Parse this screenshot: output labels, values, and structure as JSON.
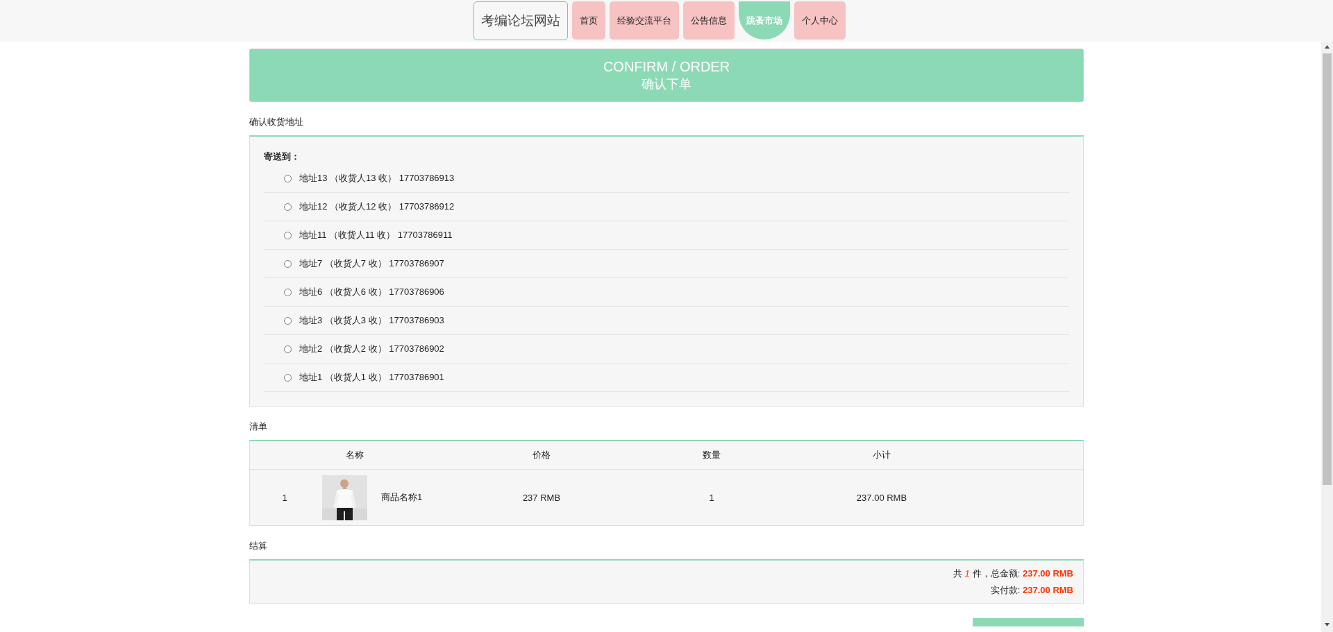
{
  "nav": {
    "brand": "考编论坛网站",
    "items": [
      {
        "label": "首页",
        "selected": false
      },
      {
        "label": "经验交流平台",
        "selected": false
      },
      {
        "label": "公告信息",
        "selected": false
      },
      {
        "label": "跳蚤市场",
        "selected": true
      },
      {
        "label": "个人中心",
        "selected": false
      }
    ]
  },
  "header": {
    "title": "CONFIRM / ORDER",
    "subtitle": "确认下单"
  },
  "address_section": {
    "title": "确认收货地址",
    "label": "寄送到：",
    "addresses": [
      {
        "text": "地址13 （收货人13 收） 17703786913",
        "selected": false
      },
      {
        "text": "地址12 （收货人12 收） 17703786912",
        "selected": false
      },
      {
        "text": "地址11 （收货人11 收） 17703786911",
        "selected": false
      },
      {
        "text": "地址7 （收货人7 收） 17703786907",
        "selected": false
      },
      {
        "text": "地址6 （收货人6 收） 17703786906",
        "selected": false
      },
      {
        "text": "地址3 （收货人3 收） 17703786903",
        "selected": false
      },
      {
        "text": "地址2 （收货人2 收） 17703786902",
        "selected": false
      },
      {
        "text": "地址1 （收货人1 收） 17703786901",
        "selected": false
      }
    ]
  },
  "list_section": {
    "title": "清单",
    "columns": [
      "名称",
      "价格",
      "数量",
      "小计"
    ],
    "rows": [
      {
        "index": "1",
        "name": "商品名称1",
        "price": "237 RMB",
        "quantity": "1",
        "subtotal": "237.00 RMB"
      }
    ]
  },
  "checkout_section": {
    "title": "结算",
    "count_prefix": "共",
    "count": "1",
    "count_suffix": "件，总金额:",
    "total": "237.00 RMB",
    "paid_label": "实付款:",
    "paid": "237.00 RMB"
  }
}
